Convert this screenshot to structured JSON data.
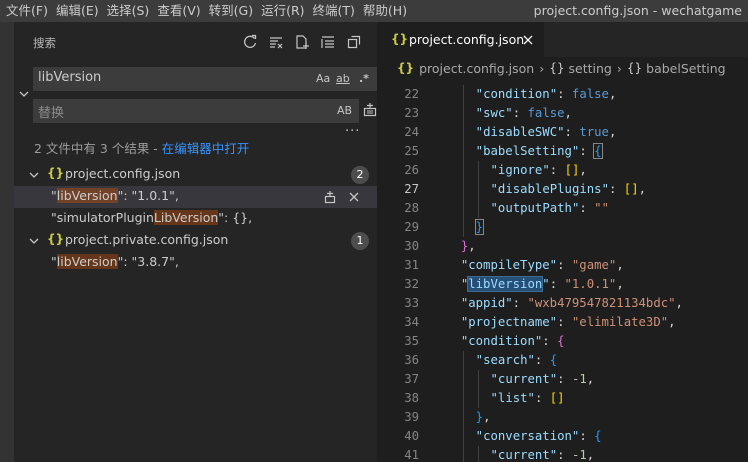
{
  "menubar": {
    "items": [
      "文件(F)",
      "编辑(E)",
      "选择(S)",
      "查看(V)",
      "转到(G)",
      "运行(R)",
      "终端(T)",
      "帮助(H)"
    ],
    "window_title": "project.config.json - wechatgame"
  },
  "sidebar": {
    "title": "搜索",
    "header_icons": [
      "refresh-icon",
      "clear-results-icon",
      "new-search-editor-icon",
      "collapse-all-icon",
      "view-as-tree-icon"
    ],
    "search": {
      "value": "libVersion",
      "options": [
        "Aa",
        "ab",
        ".*"
      ]
    },
    "replace": {
      "placeholder": "替换",
      "option": "AB"
    },
    "more": "···",
    "summary_prefix": "2 文件中有 3 个结果 - ",
    "summary_link": "在编辑器中打开",
    "files": [
      {
        "name": "project.config.json",
        "count": "2",
        "matches": [
          {
            "before": "\"",
            "match": "libVersion",
            "after": "\": \"1.0.1\","
          },
          {
            "before": "\"simulatorPlugin",
            "match": "LibVersion",
            "after": "\": {},"
          }
        ]
      },
      {
        "name": "project.private.config.json",
        "count": "1",
        "matches": [
          {
            "before": "\"",
            "match": "libVersion",
            "after": "\": \"3.8.7\","
          }
        ]
      }
    ]
  },
  "editor": {
    "tab_label": "project.config.json",
    "breadcrumb": [
      "project.config.json",
      "setting",
      "babelSetting"
    ],
    "active_line": "27",
    "lines": [
      {
        "n": "22",
        "indent": 2,
        "t": [
          [
            "\"condition\"",
            "k"
          ],
          [
            ": ",
            ""
          ],
          [
            "false",
            "b"
          ],
          [
            ",",
            ""
          ]
        ]
      },
      {
        "n": "23",
        "indent": 2,
        "t": [
          [
            "\"swc\"",
            "k"
          ],
          [
            ": ",
            ""
          ],
          [
            "false",
            "b"
          ],
          [
            ",",
            ""
          ]
        ]
      },
      {
        "n": "24",
        "indent": 2,
        "t": [
          [
            "\"disableSWC\"",
            "k"
          ],
          [
            ": ",
            ""
          ],
          [
            "true",
            "b"
          ],
          [
            ",",
            ""
          ]
        ]
      },
      {
        "n": "25",
        "indent": 2,
        "t": [
          [
            "\"babelSetting\"",
            "k"
          ],
          [
            ": ",
            ""
          ],
          [
            "{",
            "br3 brkt-match"
          ]
        ]
      },
      {
        "n": "26",
        "indent": 3,
        "t": [
          [
            "\"ignore\"",
            "k"
          ],
          [
            ": ",
            ""
          ],
          [
            "[]",
            "br1"
          ],
          [
            ",",
            ""
          ]
        ]
      },
      {
        "n": "27",
        "indent": 3,
        "t": [
          [
            "\"disablePlugins\"",
            "k"
          ],
          [
            ": ",
            ""
          ],
          [
            "[]",
            "br1"
          ],
          [
            ",",
            ""
          ]
        ]
      },
      {
        "n": "28",
        "indent": 3,
        "t": [
          [
            "\"outputPath\"",
            "k"
          ],
          [
            ": ",
            ""
          ],
          [
            "\"\"",
            "s"
          ]
        ]
      },
      {
        "n": "29",
        "indent": 2,
        "t": [
          [
            "}",
            "br3 brkt-match"
          ]
        ]
      },
      {
        "n": "30",
        "indent": 1,
        "t": [
          [
            "}",
            "br2"
          ],
          [
            ",",
            ""
          ]
        ]
      },
      {
        "n": "31",
        "indent": 1,
        "t": [
          [
            "\"compileType\"",
            "k"
          ],
          [
            ": ",
            ""
          ],
          [
            "\"game\"",
            "s"
          ],
          [
            ",",
            ""
          ]
        ]
      },
      {
        "n": "32",
        "indent": 1,
        "t": [
          [
            "\"",
            "k"
          ],
          [
            "libVersion",
            "k word-hl"
          ],
          [
            "\"",
            "k"
          ],
          [
            ": ",
            ""
          ],
          [
            "\"1.0.1\"",
            "s"
          ],
          [
            ",",
            ""
          ]
        ]
      },
      {
        "n": "33",
        "indent": 1,
        "t": [
          [
            "\"appid\"",
            "k"
          ],
          [
            ": ",
            ""
          ],
          [
            "\"wxb479547821134bdc\"",
            "s"
          ],
          [
            ",",
            ""
          ]
        ]
      },
      {
        "n": "34",
        "indent": 1,
        "t": [
          [
            "\"projectname\"",
            "k"
          ],
          [
            ": ",
            ""
          ],
          [
            "\"elimilate3D\"",
            "s"
          ],
          [
            ",",
            ""
          ]
        ]
      },
      {
        "n": "35",
        "indent": 1,
        "t": [
          [
            "\"condition\"",
            "k"
          ],
          [
            ": ",
            ""
          ],
          [
            "{",
            "br2"
          ]
        ]
      },
      {
        "n": "36",
        "indent": 2,
        "t": [
          [
            "\"search\"",
            "k"
          ],
          [
            ": ",
            ""
          ],
          [
            "{",
            "br3"
          ]
        ]
      },
      {
        "n": "37",
        "indent": 3,
        "t": [
          [
            "\"current\"",
            "k"
          ],
          [
            ": ",
            ""
          ],
          [
            "-1",
            "n"
          ],
          [
            ",",
            ""
          ]
        ]
      },
      {
        "n": "38",
        "indent": 3,
        "t": [
          [
            "\"list\"",
            "k"
          ],
          [
            ": ",
            ""
          ],
          [
            "[]",
            "br1"
          ]
        ]
      },
      {
        "n": "39",
        "indent": 2,
        "t": [
          [
            "}",
            "br3"
          ],
          [
            ",",
            ""
          ]
        ]
      },
      {
        "n": "40",
        "indent": 2,
        "t": [
          [
            "\"conversation\"",
            "k"
          ],
          [
            ": ",
            ""
          ],
          [
            "{",
            "br3"
          ]
        ]
      },
      {
        "n": "41",
        "indent": 3,
        "t": [
          [
            "\"current\"",
            "k"
          ],
          [
            ": ",
            ""
          ],
          [
            "-1",
            "n"
          ],
          [
            ",",
            ""
          ]
        ]
      }
    ]
  }
}
